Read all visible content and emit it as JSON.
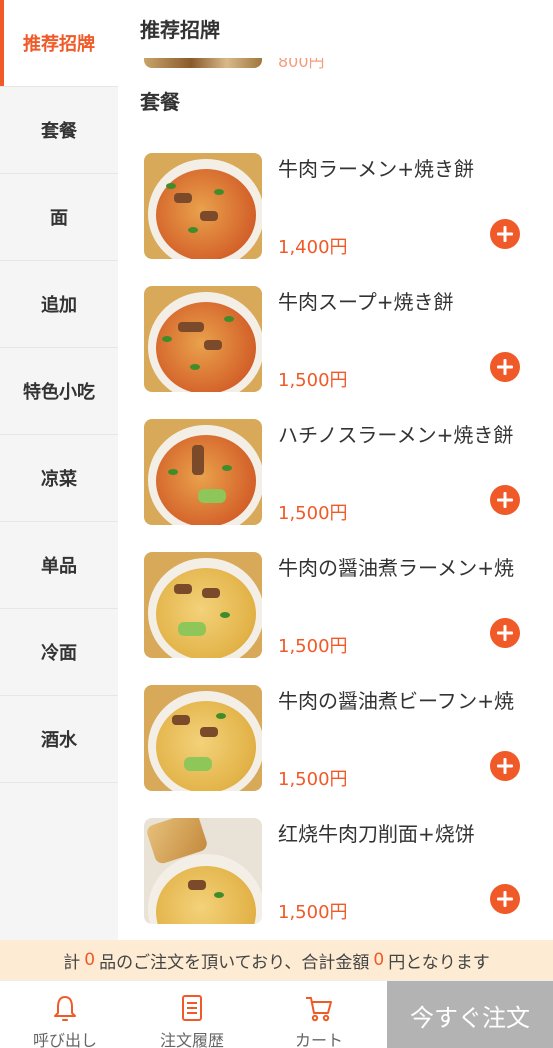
{
  "sidebar": {
    "items": [
      {
        "label": "推荐招牌",
        "active": true
      },
      {
        "label": "套餐"
      },
      {
        "label": "面"
      },
      {
        "label": "追加"
      },
      {
        "label": "特色小吃"
      },
      {
        "label": "凉菜"
      },
      {
        "label": "单品"
      },
      {
        "label": "冷面"
      },
      {
        "label": "酒水"
      }
    ]
  },
  "main": {
    "sticky_title": "推荐招牌",
    "peek_price": "800円",
    "section_title": "套餐",
    "items": [
      {
        "name": "牛肉ラーメン+焼き餅",
        "price": "1,400円",
        "image": "beef-ramen"
      },
      {
        "name": "牛肉スープ+焼き餅",
        "price": "1,500円",
        "image": "beef-soup"
      },
      {
        "name": "ハチノスラーメン+焼き餅",
        "price": "1,500円",
        "image": "tripe-ramen"
      },
      {
        "name": "牛肉の醤油煮ラーメン+焼",
        "price": "1,500円",
        "image": "braised-beef-ramen"
      },
      {
        "name": "牛肉の醤油煮ビーフン+焼",
        "price": "1,500円",
        "image": "braised-beef-rice-noodle"
      },
      {
        "name": "红烧牛肉刀削面+烧饼",
        "price": "1,500円",
        "image": "braised-beef-knife-noodle"
      }
    ]
  },
  "summary": {
    "prefix": "計",
    "count": "0",
    "middle": "品のご注文を頂いており、合計金額",
    "total": "0",
    "suffix": "円となります"
  },
  "bottom_nav": {
    "call_label": "呼び出し",
    "history_label": "注文履歴",
    "cart_label": "カート",
    "order_label": "今すぐ注文"
  },
  "colors": {
    "accent": "#f05a28",
    "summary_bg": "#fdecd3",
    "order_button_bg": "#b3b3b3",
    "sidebar_bg": "#f5f5f5"
  }
}
